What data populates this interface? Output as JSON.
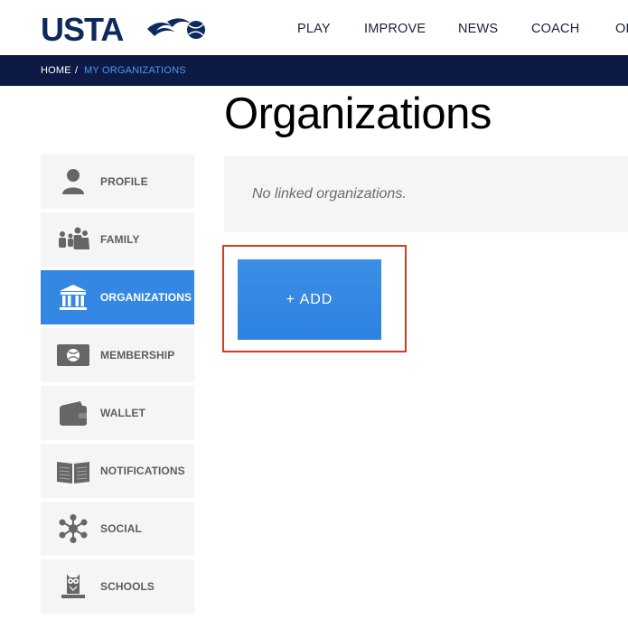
{
  "header": {
    "logo_text": "USTA",
    "nav": [
      "PLAY",
      "IMPROVE",
      "NEWS",
      "COACH",
      "OF"
    ]
  },
  "breadcrumb": {
    "home": "HOME",
    "separator": "/",
    "current": "MY ORGANIZATIONS"
  },
  "page": {
    "title": "Organizations",
    "empty_message": "No linked organizations.",
    "add_button": "+ ADD"
  },
  "sidebar": {
    "items": [
      {
        "label": "PROFILE",
        "icon": "person-icon",
        "active": false
      },
      {
        "label": "FAMILY",
        "icon": "family-icon",
        "active": false
      },
      {
        "label": "ORGANIZATIONS",
        "icon": "building-icon",
        "active": true
      },
      {
        "label": "MEMBERSHIP",
        "icon": "membership-card-icon",
        "active": false
      },
      {
        "label": "WALLET",
        "icon": "wallet-icon",
        "active": false
      },
      {
        "label": "NOTIFICATIONS",
        "icon": "newspaper-icon",
        "active": false
      },
      {
        "label": "SOCIAL",
        "icon": "social-network-icon",
        "active": false
      },
      {
        "label": "SCHOOLS",
        "icon": "owl-icon",
        "active": false
      }
    ]
  },
  "colors": {
    "navy": "#0d1a45",
    "accent_blue": "#3488e3",
    "highlight_red": "#d63a22",
    "panel_gray": "#f5f5f5"
  }
}
